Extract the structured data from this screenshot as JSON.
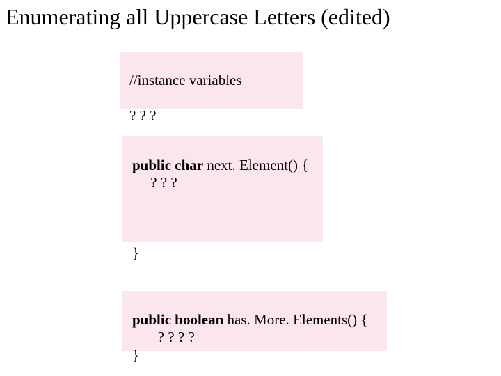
{
  "title": "Enumerating all Uppercase Letters (edited)",
  "box1": {
    "l1": "//instance variables",
    "l2": "? ? ?"
  },
  "box2": {
    "sig_kw": "public char",
    "sig_rest": " next. Element() {",
    "body": "     ? ? ?",
    "close": "}"
  },
  "box3": {
    "sig_kw": "public boolean",
    "sig_rest": " has. More. Elements() {",
    "body": "       ? ? ? ?",
    "close": "}"
  }
}
